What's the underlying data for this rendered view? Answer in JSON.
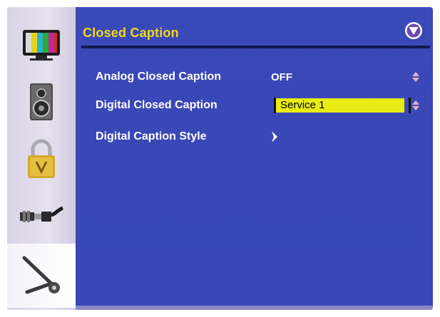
{
  "menu": {
    "title": "Closed Caption",
    "items": [
      {
        "label": "Analog Closed Caption",
        "value": "OFF",
        "control": "up-down-arrows"
      },
      {
        "label": "Digital Closed Caption",
        "value": "Service 1",
        "control": "up-down-arrows",
        "selected": true
      },
      {
        "label": "Digital Caption Style",
        "value": "",
        "control": "chevron-right-arrow"
      }
    ]
  },
  "sidebar": {
    "items": [
      {
        "icon": "tv-picture-icon"
      },
      {
        "icon": "speaker-audio-icon"
      },
      {
        "icon": "padlock-parental-icon"
      },
      {
        "icon": "cable-connector-icon"
      },
      {
        "icon": "tools-setup-icon",
        "active": true
      }
    ]
  },
  "colors": {
    "panel": "#3948b6",
    "title": "#f2d71a",
    "highlight": "#e9ec12",
    "text": "#ffffff"
  }
}
